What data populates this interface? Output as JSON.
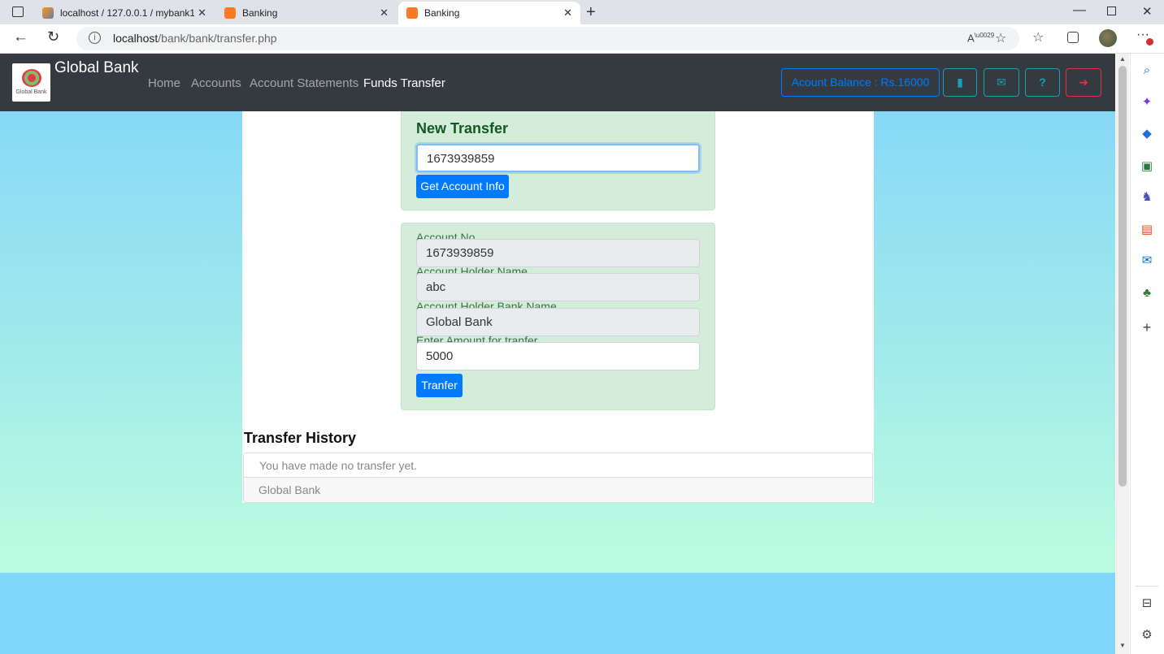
{
  "browser": {
    "tabs": [
      {
        "title": "localhost / 127.0.0.1 / mybank1 |",
        "active": false
      },
      {
        "title": "Banking",
        "active": false
      },
      {
        "title": "Banking",
        "active": true
      }
    ],
    "url_host": "localhost",
    "url_path": "/bank/bank/transfer.php"
  },
  "navbar": {
    "brand": "Global Bank",
    "logo_text": "Global Bank",
    "links": [
      "Home",
      "Accounts",
      "Account Statements",
      "Funds Transfer"
    ],
    "balance": "Acount Balance : Rs.16000"
  },
  "new_transfer": {
    "title": "New Transfer",
    "account_input": "1673939859",
    "button": "Get Account Info"
  },
  "account_info": {
    "account_no_label": "Account No.",
    "account_no": "1673939859",
    "holder_name_label": "Account Holder Name.",
    "holder_name": "abc",
    "bank_name_label": "Account Holder Bank Name.",
    "bank_name": "Global Bank",
    "amount_label": "Enter Amount for tranfer.",
    "amount": "5000",
    "button": "Tranfer"
  },
  "history": {
    "title": "Transfer History",
    "empty_text": "You have made no transfer yet.",
    "footer": "Global Bank"
  },
  "colors": {
    "navbar": "#343a40",
    "primary": "#007bff",
    "info": "#17a2b8",
    "danger": "#dc3545",
    "card_success": "#d4edda"
  }
}
